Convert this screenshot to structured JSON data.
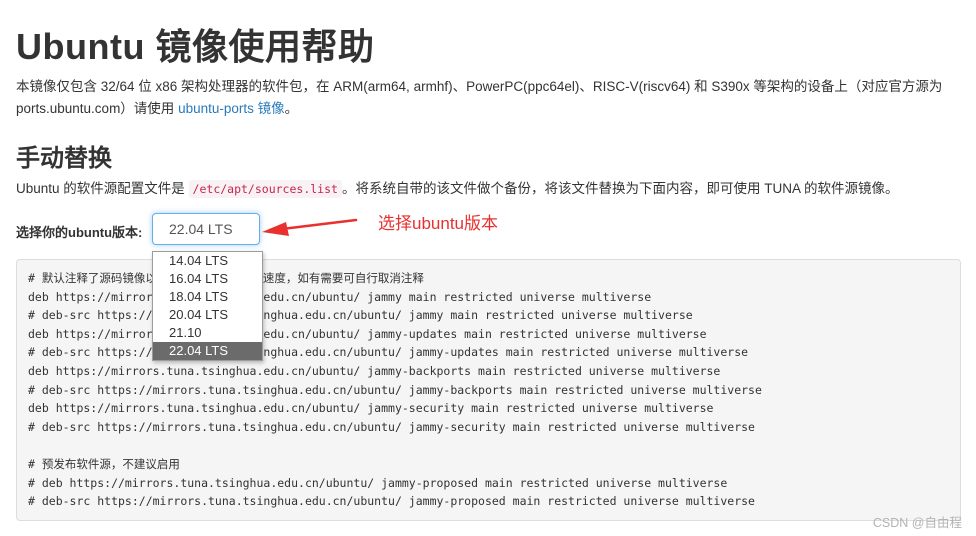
{
  "header": {
    "title": "Ubuntu 镜像使用帮助"
  },
  "intro": {
    "text_before_link": "本镜像仅包含 32/64 位 x86 架构处理器的软件包，在 ARM(arm64, armhf)、PowerPC(ppc64el)、RISC-V(riscv64) 和 S390x 等架构的设备上（对应官方源为ports.ubuntu.com）请使用 ",
    "link_text": "ubuntu-ports 镜像",
    "text_after_link": "。"
  },
  "manual": {
    "title": "手动替换",
    "desc_prefix": "Ubuntu 的软件源配置文件是 ",
    "desc_code": "/etc/apt/sources.list",
    "desc_suffix": "。将系统自带的该文件做个备份，将该文件替换为下面内容，即可使用 TUNA 的软件源镜像。"
  },
  "version_picker": {
    "label": "选择你的ubuntu版本:",
    "selected_value": "22.04 LTS",
    "options": [
      "14.04 LTS",
      "16.04 LTS",
      "18.04 LTS",
      "20.04 LTS",
      "21.10",
      "22.04 LTS"
    ],
    "selected_index": 5
  },
  "annotation": {
    "text": "选择ubuntu版本",
    "color": "#e8312f"
  },
  "code_lines": [
    "# 默认注释了源码镜像以提高 apt update 速度，如有需要可自行取消注释",
    "deb https://mirrors.tuna.tsinghua.edu.cn/ubuntu/ jammy main restricted universe multiverse",
    "# deb-src https://mirrors.tuna.tsinghua.edu.cn/ubuntu/ jammy main restricted universe multiverse",
    "deb https://mirrors.tuna.tsinghua.edu.cn/ubuntu/ jammy-updates main restricted universe multiverse",
    "# deb-src https://mirrors.tuna.tsinghua.edu.cn/ubuntu/ jammy-updates main restricted universe multiverse",
    "deb https://mirrors.tuna.tsinghua.edu.cn/ubuntu/ jammy-backports main restricted universe multiverse",
    "# deb-src https://mirrors.tuna.tsinghua.edu.cn/ubuntu/ jammy-backports main restricted universe multiverse",
    "deb https://mirrors.tuna.tsinghua.edu.cn/ubuntu/ jammy-security main restricted universe multiverse",
    "# deb-src https://mirrors.tuna.tsinghua.edu.cn/ubuntu/ jammy-security main restricted universe multiverse",
    "",
    "# 预发布软件源，不建议启用",
    "# deb https://mirrors.tuna.tsinghua.edu.cn/ubuntu/ jammy-proposed main restricted universe multiverse",
    "# deb-src https://mirrors.tuna.tsinghua.edu.cn/ubuntu/ jammy-proposed main restricted universe multiverse"
  ],
  "watermark": "CSDN @自由程"
}
